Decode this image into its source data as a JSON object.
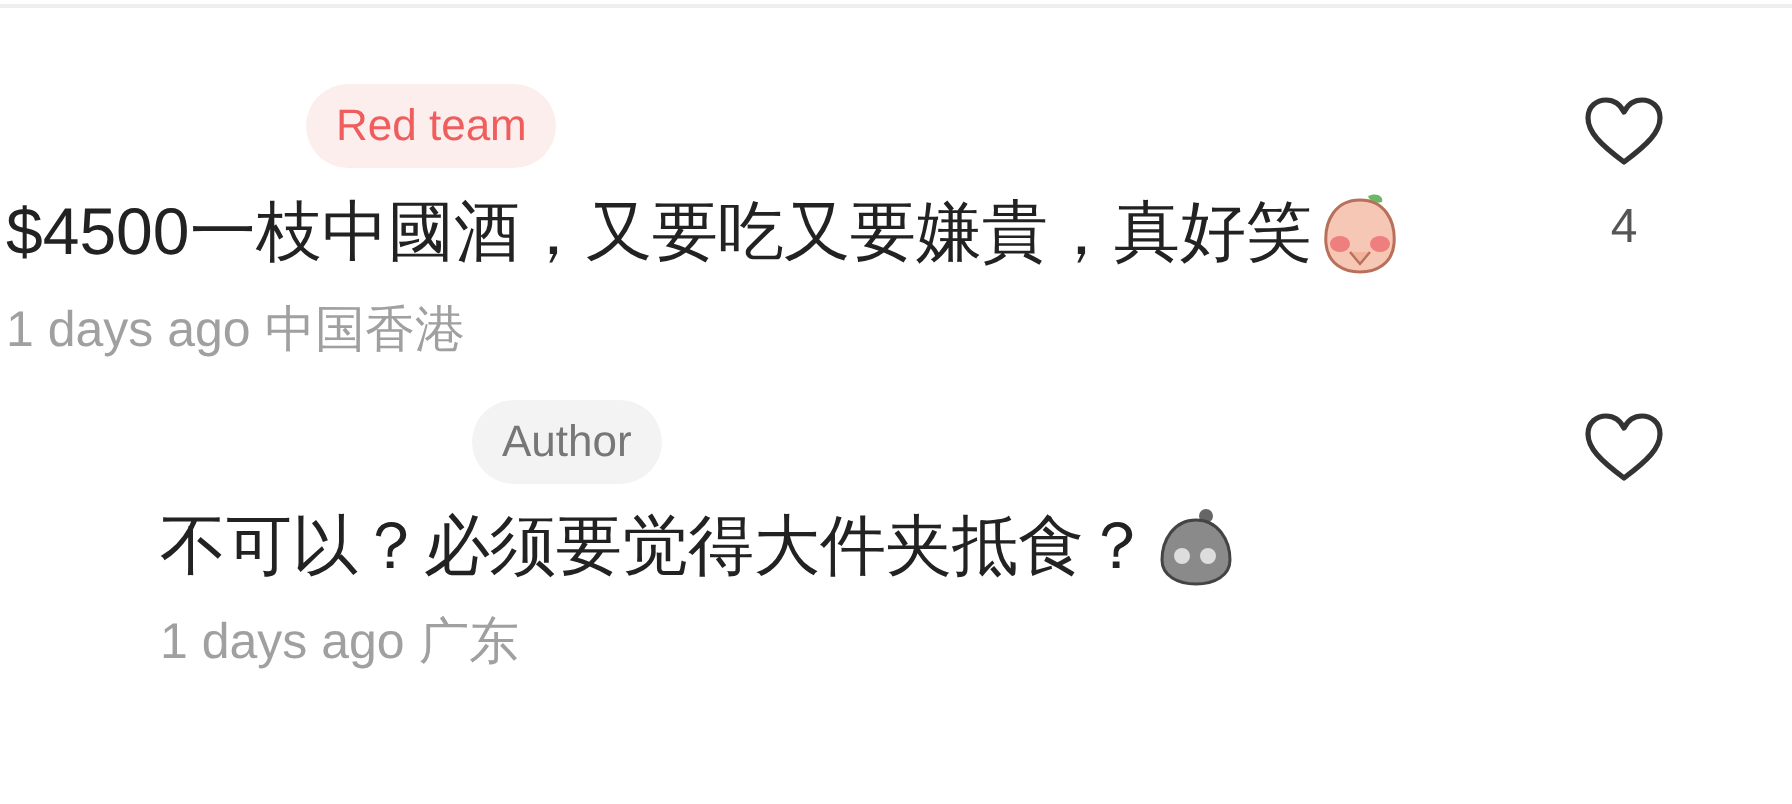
{
  "comments": [
    {
      "badge": {
        "kind": "team",
        "label": "Red team"
      },
      "text": "$4500一枝中國酒，又要吃又要嫌貴，真好笑",
      "sticker": {
        "kind": "peach"
      },
      "time": "1 days ago",
      "location": "中国香港",
      "likes": "4",
      "reply": false
    },
    {
      "badge": {
        "kind": "author",
        "label": "Author"
      },
      "text": "不可以？必须要觉得大件夹抵食？",
      "sticker": {
        "kind": "bag"
      },
      "time": "1 days ago",
      "location": "广东",
      "reply": true
    }
  ]
}
